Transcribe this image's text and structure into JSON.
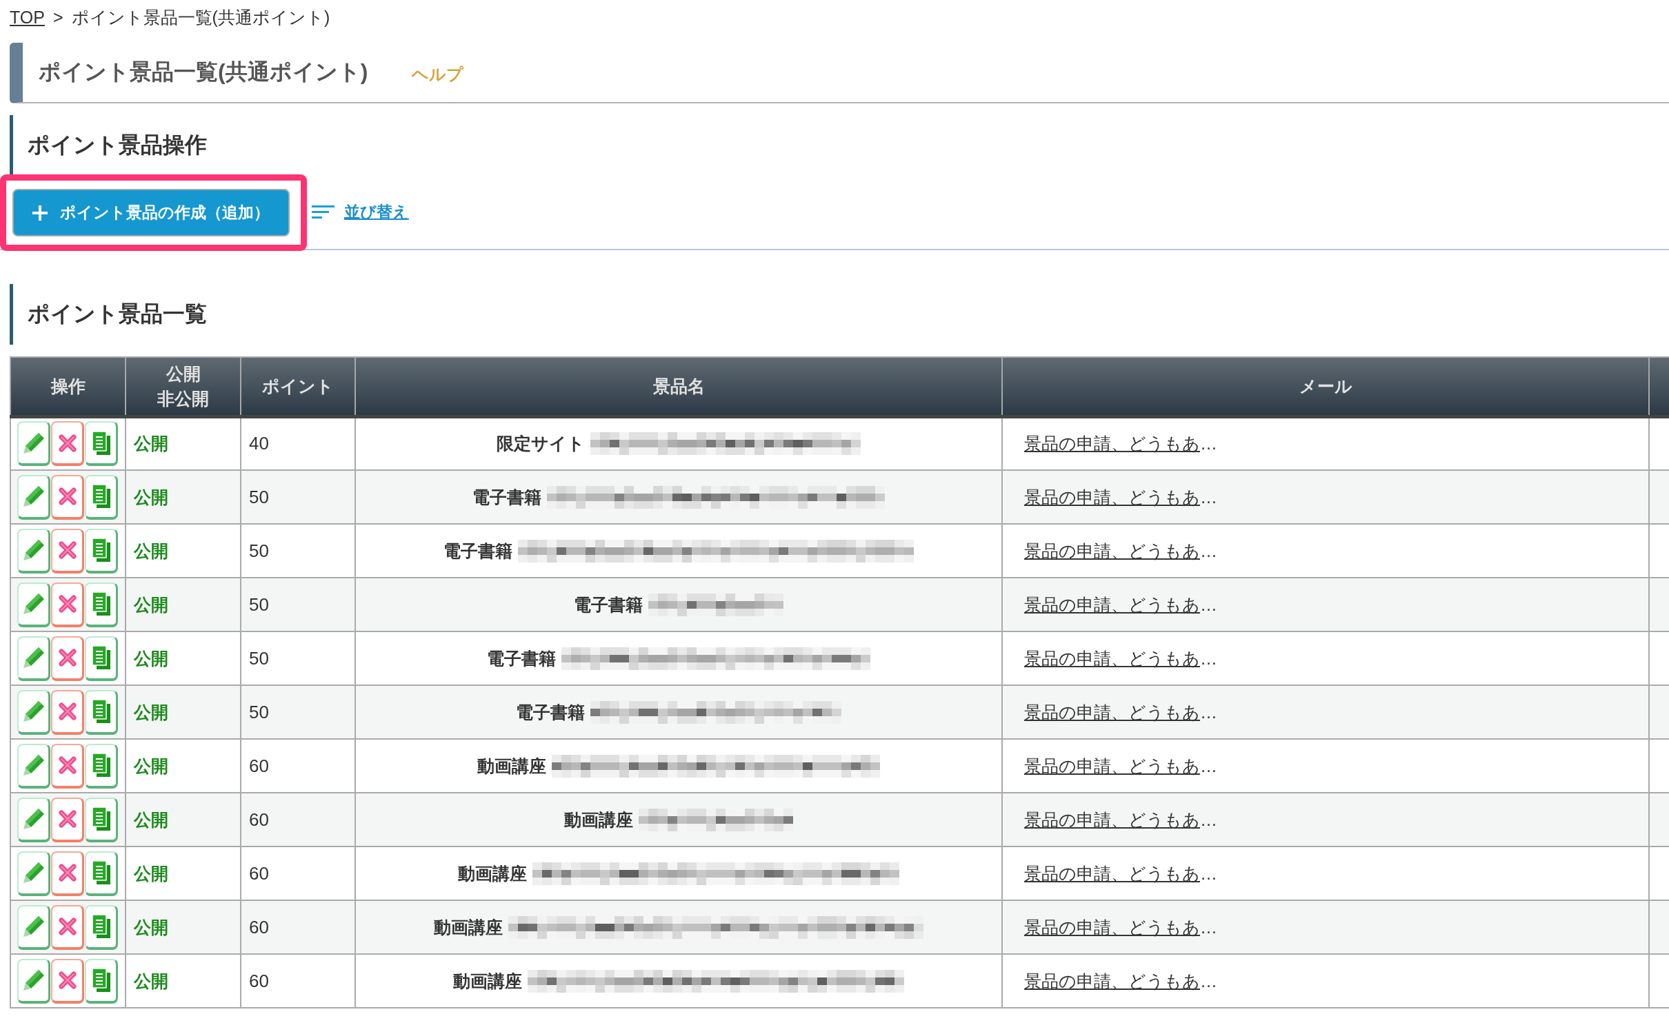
{
  "breadcrumb": [
    {
      "kind": "link",
      "label": "TOP"
    },
    {
      "kind": "separator",
      "label": ">"
    },
    {
      "kind": "current",
      "label": "ポイント景品一覧(共通ポイント)"
    }
  ],
  "page_header": {
    "title": "ポイント景品一覧(共通ポイント)",
    "help_link": "ヘルプ"
  },
  "operations": {
    "heading": "ポイント景品操作",
    "create_button": {
      "label": "ポイント景品の作成（追加）",
      "highlighted": true
    },
    "sort_link": "並び替え"
  },
  "prize_list": {
    "heading": "ポイント景品一覧",
    "table": {
      "columns": [
        {
          "lines": [
            "操作"
          ]
        },
        {
          "lines": [
            "公開",
            "非公開"
          ]
        },
        {
          "lines": [
            "ポイント"
          ]
        },
        {
          "lines": [
            "景品名"
          ]
        },
        {
          "lines": [
            "メール"
          ]
        }
      ],
      "rows": [
        {
          "status": "公開",
          "points": "40",
          "prize_name": "限定サイト",
          "mail_link": "景品の申請、どうもあ",
          "mail_more": "…"
        },
        {
          "status": "公開",
          "points": "50",
          "prize_name": "電子書籍",
          "mail_link": "景品の申請、どうもあ",
          "mail_more": "…"
        },
        {
          "status": "公開",
          "points": "50",
          "prize_name": "電子書籍",
          "mail_link": "景品の申請、どうもあ",
          "mail_more": "…"
        },
        {
          "status": "公開",
          "points": "50",
          "prize_name": "電子書籍",
          "mail_link": "景品の申請、どうもあ",
          "mail_more": "…"
        },
        {
          "status": "公開",
          "points": "50",
          "prize_name": "電子書籍",
          "mail_link": "景品の申請、どうもあ",
          "mail_more": "…"
        },
        {
          "status": "公開",
          "points": "50",
          "prize_name": "電子書籍",
          "mail_link": "景品の申請、どうもあ",
          "mail_more": "…"
        },
        {
          "status": "公開",
          "points": "60",
          "prize_name": "動画講座",
          "mail_link": "景品の申請、どうもあ",
          "mail_more": "…"
        },
        {
          "status": "公開",
          "points": "60",
          "prize_name": "動画講座",
          "mail_link": "景品の申請、どうもあ",
          "mail_more": "…"
        },
        {
          "status": "公開",
          "points": "60",
          "prize_name": "動画講座",
          "mail_link": "景品の申請、どうもあ",
          "mail_more": "…"
        },
        {
          "status": "公開",
          "points": "60",
          "prize_name": "動画講座",
          "mail_link": "景品の申請、どうもあ",
          "mail_more": "…"
        },
        {
          "status": "公開",
          "points": "60",
          "prize_name": "動画講座",
          "mail_link": "景品の申請、どうもあ",
          "mail_more": "…"
        }
      ]
    }
  }
}
